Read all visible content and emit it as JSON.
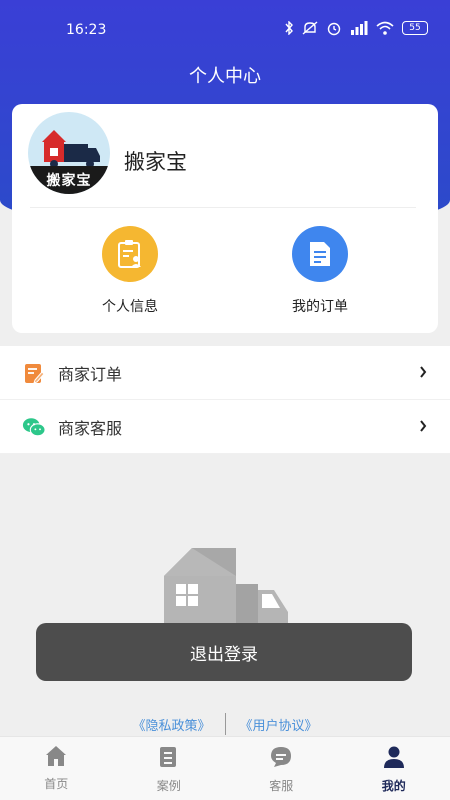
{
  "status_bar": {
    "time": "16:23",
    "battery": "55"
  },
  "header": {
    "title": "个人中心"
  },
  "profile": {
    "avatar_text": "搬家宝",
    "name": "搬家宝",
    "quick_actions": [
      {
        "label": "个人信息",
        "icon": "clipboard-user-icon",
        "color": "#f5b731"
      },
      {
        "label": "我的订单",
        "icon": "document-icon",
        "color": "#3f86ee"
      }
    ]
  },
  "menu": [
    {
      "label": "商家订单",
      "icon": "edit-order-icon",
      "color": "#f08a3c"
    },
    {
      "label": "商家客服",
      "icon": "wechat-icon",
      "color": "#2dc78a"
    }
  ],
  "toast": {
    "text": "退出登录"
  },
  "footer_links": {
    "privacy": "《隐私政策》",
    "agreement": "《用户协议》"
  },
  "tabs": [
    {
      "label": "首页",
      "icon": "home-icon",
      "active": false
    },
    {
      "label": "案例",
      "icon": "list-icon",
      "active": false
    },
    {
      "label": "客服",
      "icon": "chat-icon",
      "active": false
    },
    {
      "label": "我的",
      "icon": "user-icon",
      "active": true
    }
  ]
}
